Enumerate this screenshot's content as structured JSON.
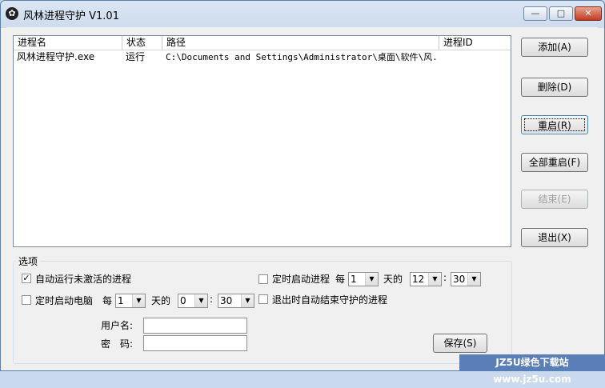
{
  "window": {
    "title": "风林进程守护 V1.01",
    "icon": "gear-icon"
  },
  "titlebar_buttons": {
    "min": "—",
    "max": "□",
    "close": "✕"
  },
  "list": {
    "headers": [
      "进程名",
      "状态",
      "路径",
      "进程ID"
    ],
    "rows": [
      {
        "name": "风林进程守护.exe",
        "status": "运行",
        "path": "C:\\Documents and Settings\\Administrator\\桌面\\软件\\风...",
        "pid": ""
      }
    ]
  },
  "buttons": {
    "add": "添加(A)",
    "delete": "删除(D)",
    "restart": "重启(R)",
    "restart_all": "全部重启(F)",
    "end": "结束(E)",
    "exit": "退出(X)"
  },
  "options": {
    "legend": "选项",
    "auto_run": {
      "label": "自动运行未激活的进程",
      "checked": true
    },
    "timed_start_pc": {
      "label": "定时启动电脑",
      "checked": false,
      "every": "每",
      "days_value": "1",
      "days_unit": "天的",
      "hour": "0",
      "colon": ":",
      "minute": "30"
    },
    "timed_start_proc": {
      "label": "定时启动进程",
      "checked": false,
      "every": "每",
      "days_value": "1",
      "days_unit": "天的",
      "hour": "12",
      "colon": ":",
      "minute": "30"
    },
    "exit_end_guard": {
      "label": "退出时自动结束守护的进程",
      "checked": false
    },
    "username_label": "用户名:",
    "password_label": "密　码:",
    "username_value": "",
    "password_value": "",
    "save": "保存(S)"
  },
  "watermark": "JZ5U绿色下载站 www.jz5u.com"
}
